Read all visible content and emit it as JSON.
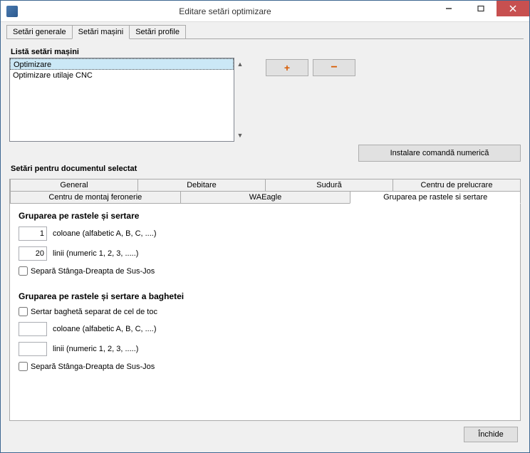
{
  "window": {
    "title": "Editare setări optimizare"
  },
  "top_tabs": {
    "t0": "Setări generale",
    "t1": "Setări mașini",
    "t2": "Setări profile"
  },
  "machines": {
    "label": "Listă setări mașini",
    "items": [
      "Optimizare",
      "Optimizare utilaje CNC"
    ]
  },
  "buttons": {
    "install": "Instalare comandă numerică",
    "close": "Închide"
  },
  "doc_section_label": "Setări pentru documentul selectat",
  "doc_tabs_row1": {
    "t0": "General",
    "t1": "Debitare",
    "t2": "Sudură",
    "t3": "Centru de prelucrare"
  },
  "doc_tabs_row2": {
    "t0": "Centru de montaj feronerie",
    "t1": "WAEagle",
    "t2": "Gruparea pe rastele si sertare"
  },
  "group1": {
    "title": "Gruparea pe rastele și sertare",
    "cols_value": "1",
    "cols_label": "coloane (alfabetic A, B, C, ....)",
    "rows_value": "20",
    "rows_label": "linii (numeric 1, 2, 3,  .....)",
    "sep_label": "Separă Stânga-Dreapta de Sus-Jos"
  },
  "group2": {
    "title": "Gruparea pe rastele și sertare a baghetei",
    "sertar_label": "Sertar baghetă separat de cel de toc",
    "cols_value": "",
    "cols_label": "coloane (alfabetic A, B, C, ....)",
    "rows_value": "",
    "rows_label": "linii (numeric 1, 2, 3,  .....)",
    "sep_label": "Separă Stânga-Dreapta de Sus-Jos"
  }
}
